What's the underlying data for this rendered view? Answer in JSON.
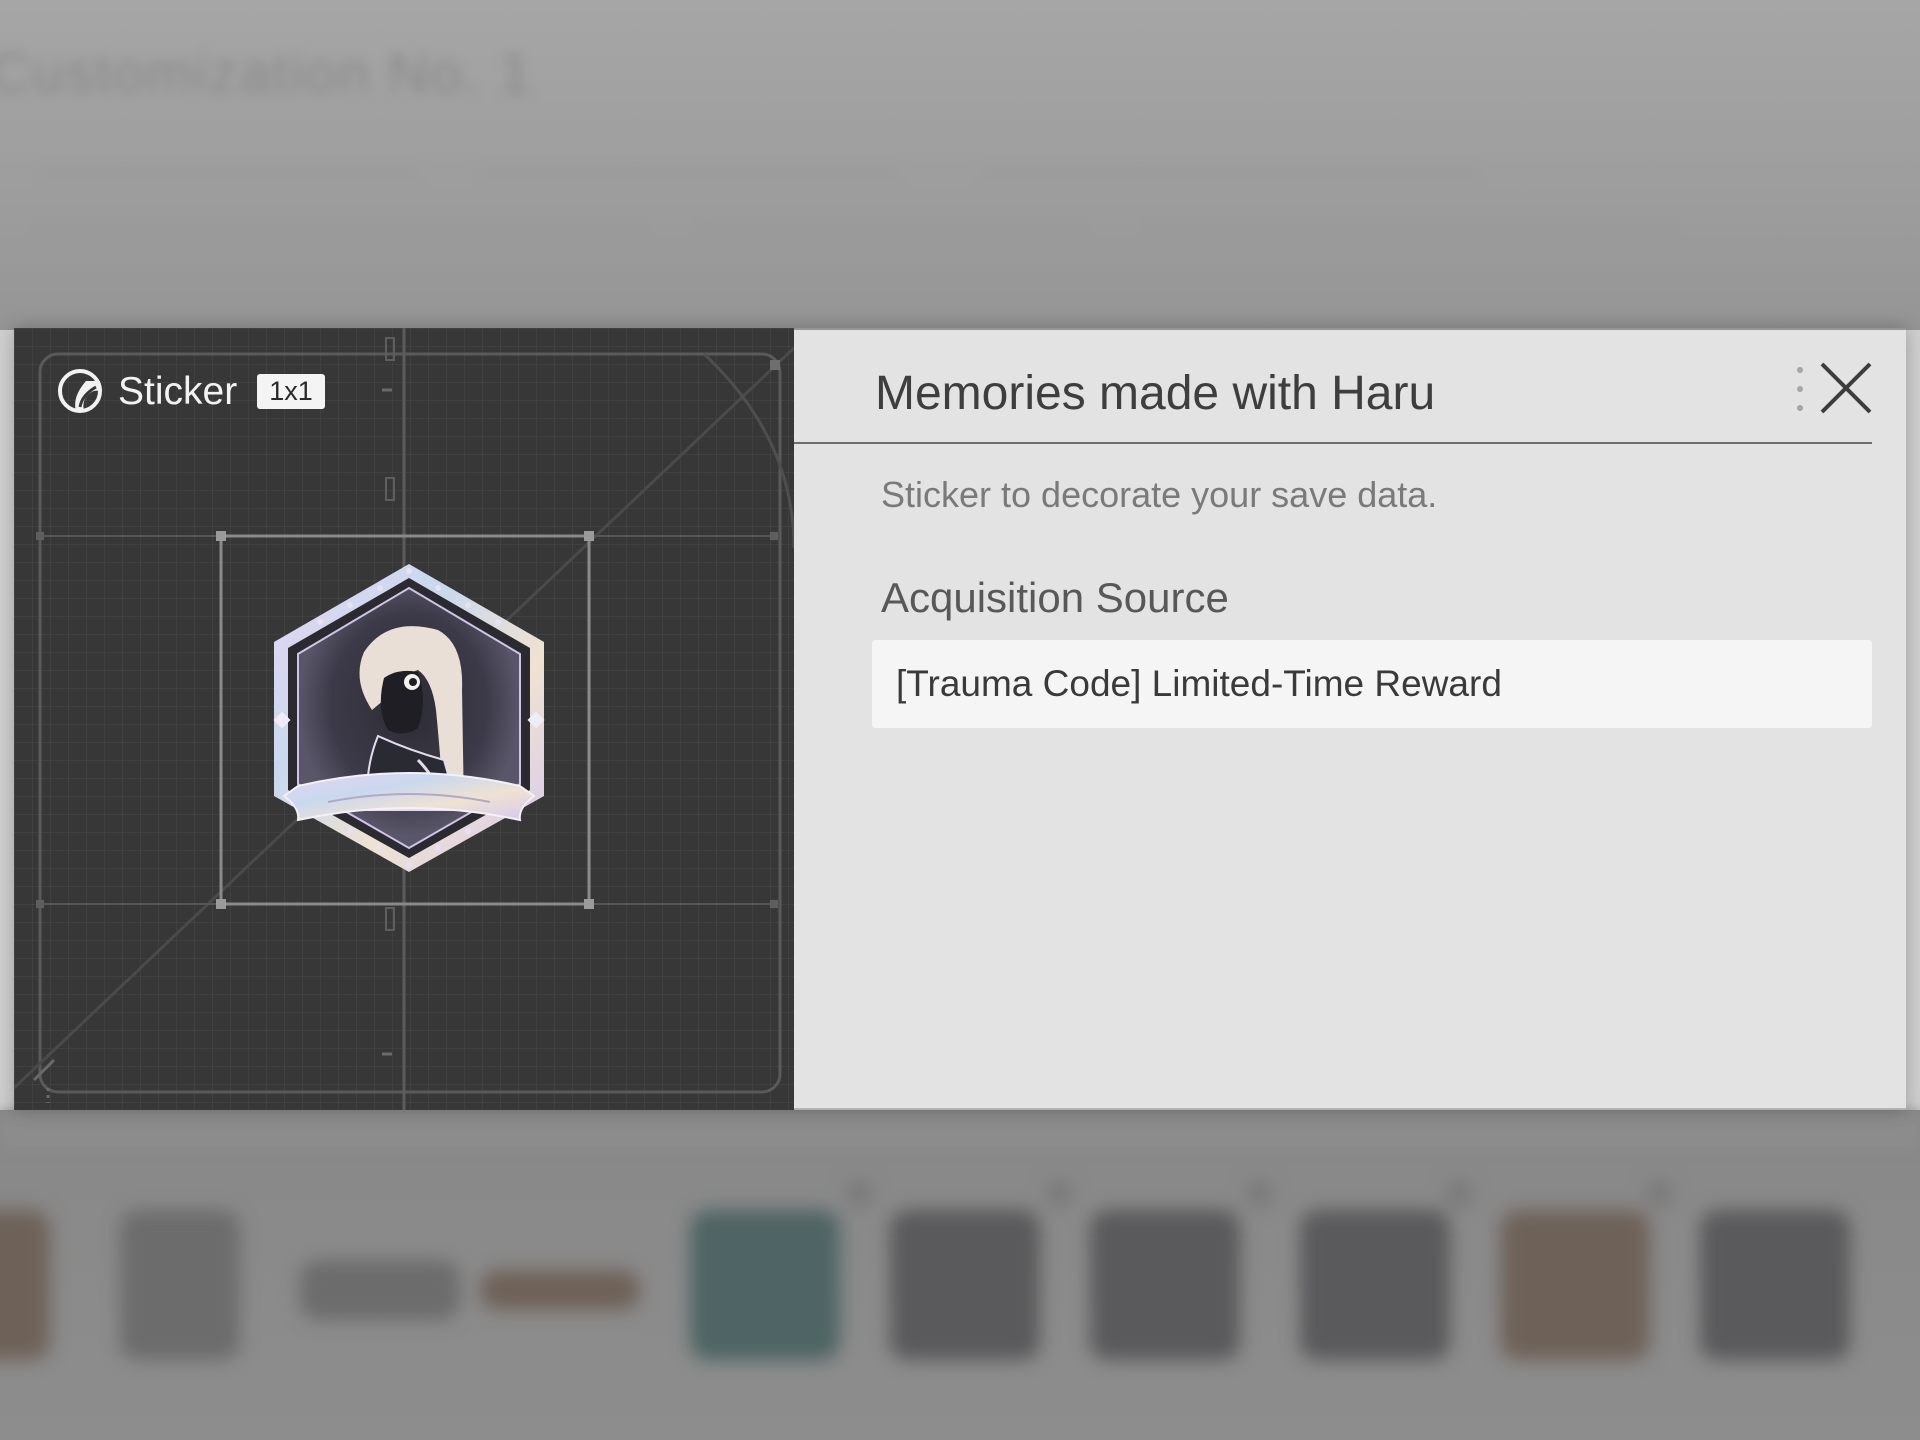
{
  "background": {
    "screen_title": "Customization No. 1"
  },
  "preview": {
    "kind_icon": "sticker-icon",
    "kind_label": "Sticker",
    "size_badge": "1x1",
    "art": "haru-hexagon-sticker"
  },
  "info": {
    "title": "Memories made with Haru",
    "description": "Sticker to decorate your save data.",
    "section_heading": "Acquisition Source",
    "source": "[Trauma Code] Limited-Time Reward",
    "more_icon": "vertical-dots-icon",
    "close_icon": "close-icon"
  },
  "colors": {
    "preview_bg": "#373737",
    "info_bg": "#e3e3e3",
    "source_box_bg": "#f5f5f5",
    "title_text": "#3e3e3e",
    "description_text": "#7a7a7a"
  }
}
